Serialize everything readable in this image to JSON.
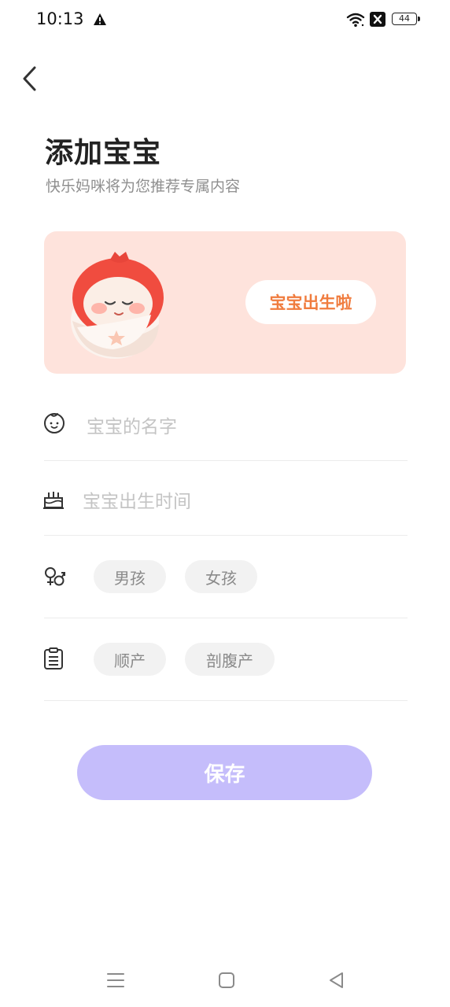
{
  "status_bar": {
    "time": "10:13",
    "battery_level": "44",
    "icons": [
      "alert-icon",
      "wifi-icon",
      "no-sim-icon",
      "battery-icon"
    ]
  },
  "header": {
    "title": "添加宝宝",
    "subtitle": "快乐妈咪将为您推荐专属内容"
  },
  "banner": {
    "button_label": "宝宝出生啦",
    "background_color": "#fee3dc",
    "accent_color": "#f07c3e"
  },
  "form": {
    "name_placeholder": "宝宝的名字",
    "birth_placeholder": "宝宝出生时间",
    "gender_options": [
      "男孩",
      "女孩"
    ],
    "delivery_options": [
      "顺产",
      "剖腹产"
    ]
  },
  "actions": {
    "save_label": "保存",
    "save_color": "#c5bdfb"
  },
  "nav_bar": {
    "icons": [
      "menu-icon",
      "home-icon",
      "back-icon"
    ]
  }
}
